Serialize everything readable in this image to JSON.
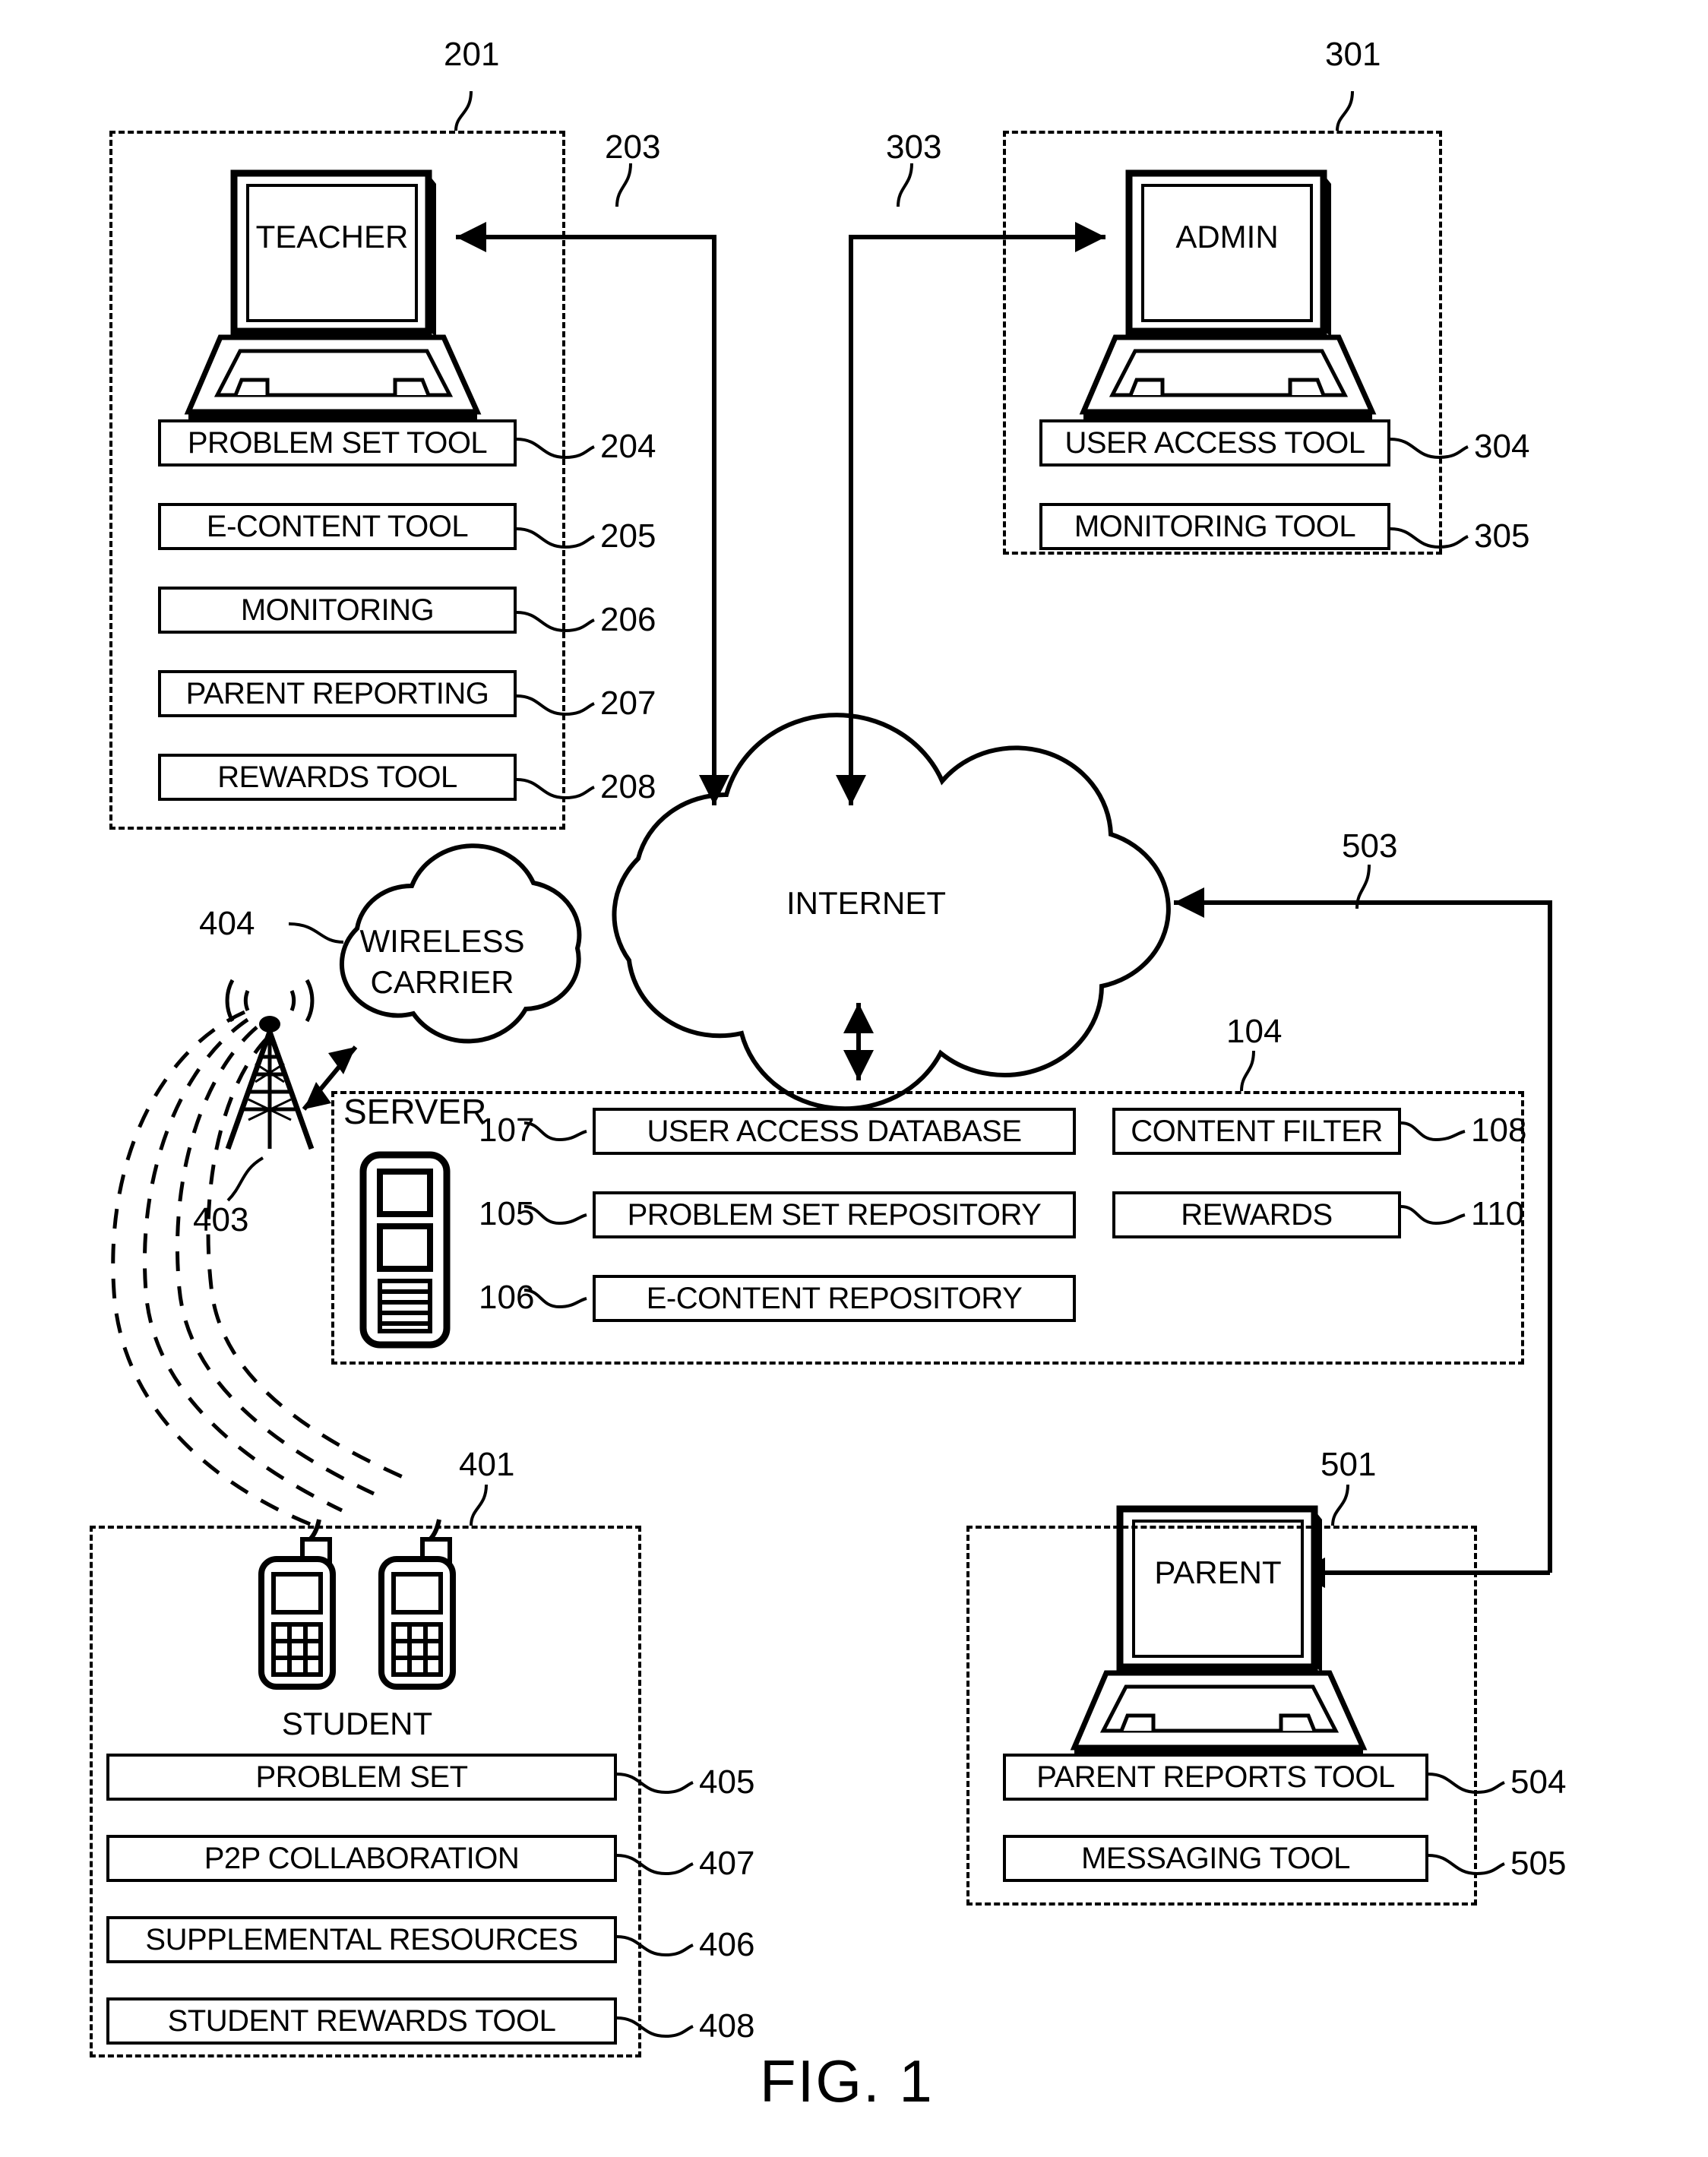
{
  "figure": {
    "title": "FIG. 1",
    "line_color": "#000000",
    "background": "#ffffff"
  },
  "teacher_group": {
    "ref": "201",
    "device_label": "TEACHER",
    "link_ref": "203",
    "tools": [
      {
        "label": "PROBLEM SET TOOL",
        "ref": "204"
      },
      {
        "label": "E-CONTENT TOOL",
        "ref": "205"
      },
      {
        "label": "MONITORING",
        "ref": "206"
      },
      {
        "label": "PARENT REPORTING",
        "ref": "207"
      },
      {
        "label": "REWARDS TOOL",
        "ref": "208"
      }
    ]
  },
  "admin_group": {
    "ref": "301",
    "device_label": "ADMIN",
    "link_ref": "303",
    "tools": [
      {
        "label": "USER ACCESS TOOL",
        "ref": "304"
      },
      {
        "label": "MONITORING TOOL",
        "ref": "305"
      }
    ]
  },
  "network": {
    "internet_label": "INTERNET",
    "wireless_label_line1": "WIRELESS",
    "wireless_label_line2": "CARRIER",
    "wireless_ref": "404",
    "tower_ref": "403"
  },
  "server_group": {
    "ref": "104",
    "title": "SERVER",
    "tools": [
      {
        "label": "USER ACCESS DATABASE",
        "ref": "107"
      },
      {
        "label": "CONTENT FILTER",
        "ref": "108"
      },
      {
        "label": "PROBLEM SET REPOSITORY",
        "ref": "105"
      },
      {
        "label": "REWARDS",
        "ref": "110"
      },
      {
        "label": "E-CONTENT REPOSITORY",
        "ref": "106"
      }
    ]
  },
  "student_group": {
    "ref": "401",
    "device_label": "STUDENT",
    "tools": [
      {
        "label": "PROBLEM SET",
        "ref": "405"
      },
      {
        "label": "P2P COLLABORATION",
        "ref": "407"
      },
      {
        "label": "SUPPLEMENTAL RESOURCES",
        "ref": "406"
      },
      {
        "label": "STUDENT REWARDS TOOL",
        "ref": "408"
      }
    ]
  },
  "parent_group": {
    "ref": "501",
    "device_label": "PARENT",
    "link_ref": "503",
    "tools": [
      {
        "label": "PARENT REPORTS TOOL",
        "ref": "504"
      },
      {
        "label": "MESSAGING TOOL",
        "ref": "505"
      }
    ]
  }
}
